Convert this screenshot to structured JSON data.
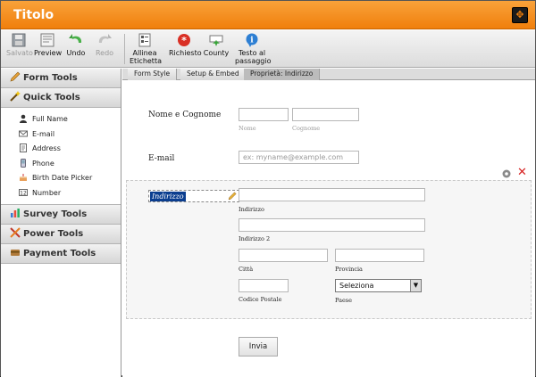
{
  "window": {
    "title": "Titolo"
  },
  "toolbar": {
    "buttons": [
      {
        "label": "Salvato",
        "icon": "floppy-icon",
        "disabled": true
      },
      {
        "label": "Preview",
        "icon": "preview-icon",
        "disabled": false
      },
      {
        "label": "Undo",
        "icon": "undo-icon",
        "disabled": false
      },
      {
        "label": "Redo",
        "icon": "redo-icon",
        "disabled": true
      },
      {
        "label": "Allinea Etichetta",
        "icon": "align-label-icon",
        "disabled": false
      },
      {
        "label": "Richiesto",
        "icon": "required-icon",
        "disabled": false
      },
      {
        "label": "County",
        "icon": "county-icon",
        "disabled": false
      },
      {
        "label": "Testo al passaggio",
        "icon": "hover-text-icon",
        "disabled": false
      }
    ]
  },
  "sidebar": {
    "categories": {
      "form_tools": "Form Tools",
      "quick_tools": "Quick Tools",
      "survey_tools": "Survey Tools",
      "power_tools": "Power Tools",
      "payment_tools": "Payment Tools"
    },
    "quick_items": [
      "Full Name",
      "E-mail",
      "Address",
      "Phone",
      "Birth Date Picker",
      "Number"
    ]
  },
  "tabs": [
    "Form Style",
    "Setup & Embed",
    "Proprietà: Indirizzo"
  ],
  "form": {
    "name_label": "Nome e Cognome",
    "first_sub": "Nome",
    "last_sub": "Cognome",
    "email_label": "E-mail",
    "email_placeholder": "ex: myname@example.com",
    "address_label": "Indirizzo",
    "address_sub": "Indirizzo",
    "address2_sub": "Indirizzo 2",
    "city_sub": "Città",
    "province_sub": "Provincia",
    "zip_sub": "Codice Postale",
    "country_sub": "Paese",
    "country_select": "Seleziona",
    "submit": "Invia"
  },
  "colors": {
    "titlebar": "#f07f0c",
    "selection": "#0b3e8f",
    "delete": "#d62020"
  }
}
